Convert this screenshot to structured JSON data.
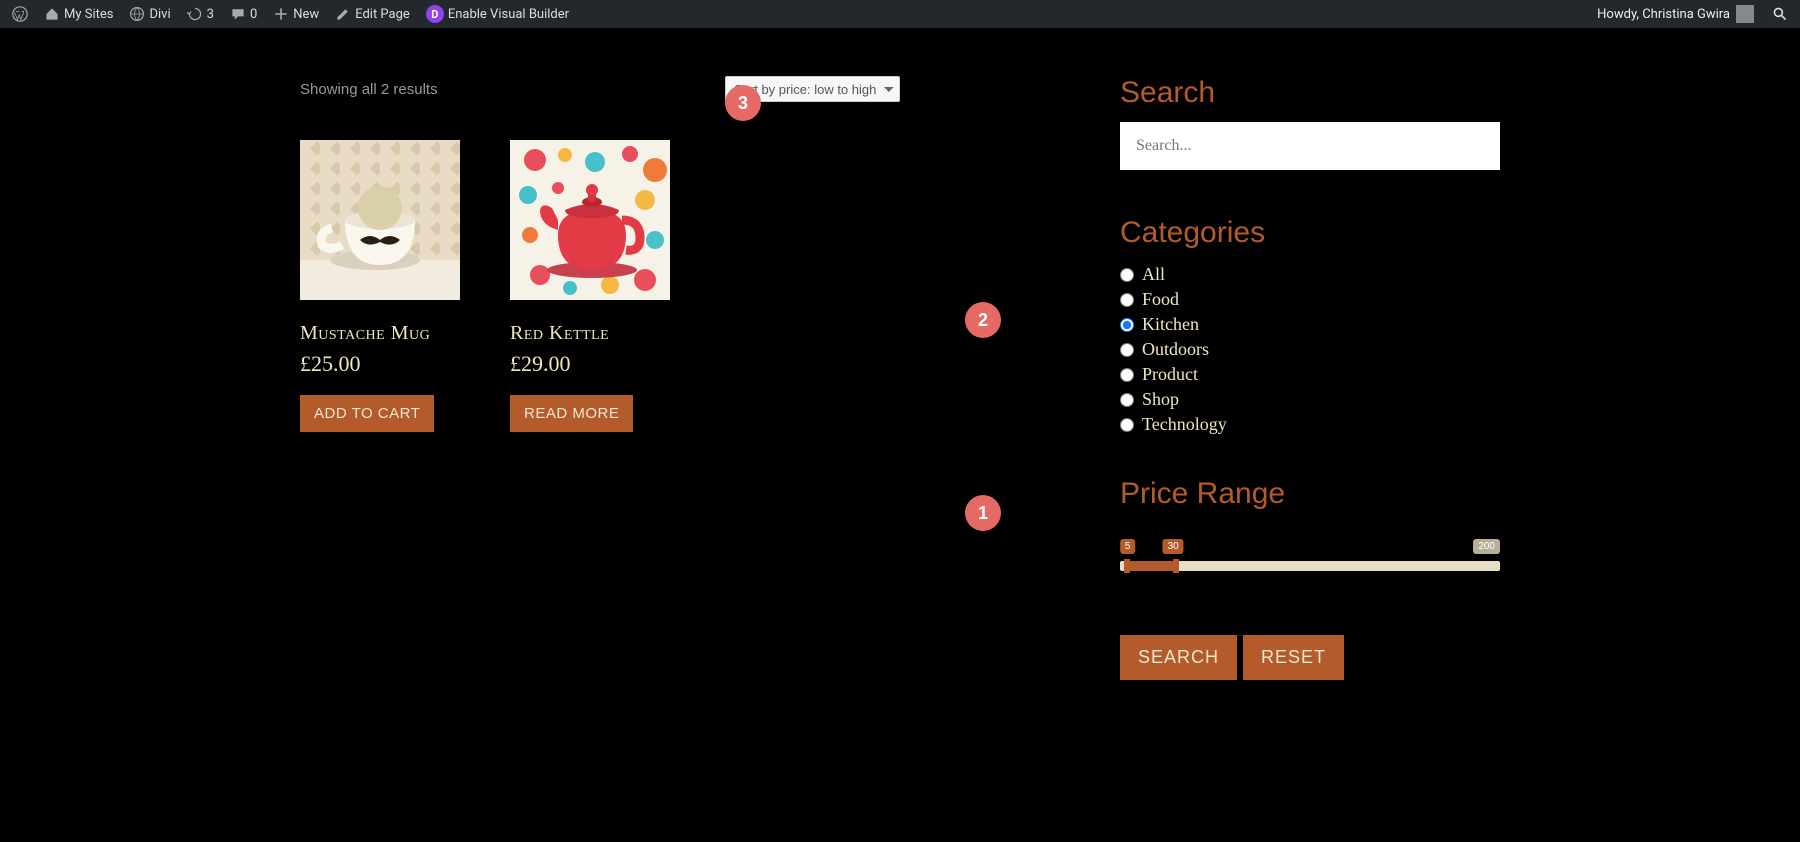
{
  "adminbar": {
    "my_sites": "My Sites",
    "site_name": "Divi",
    "updates": "3",
    "comments": "0",
    "new": "New",
    "edit_page": "Edit Page",
    "enable_vb": "Enable Visual Builder",
    "howdy": "Howdy, Christina Gwira"
  },
  "shop": {
    "result_text": "Showing all 2 results",
    "sort_selected": "Sort by price: low to high",
    "products": [
      {
        "name": "Mustache Mug",
        "price": "£25.00",
        "button": "ADD TO CART"
      },
      {
        "name": "Red Kettle",
        "price": "£29.00",
        "button": "READ MORE"
      }
    ]
  },
  "sidebar": {
    "search_title": "Search",
    "search_placeholder": "Search...",
    "categories_title": "Categories",
    "categories": [
      "All",
      "Food",
      "Kitchen",
      "Outdoors",
      "Product",
      "Shop",
      "Technology"
    ],
    "selected_category": "Kitchen",
    "price_title": "Price Range",
    "slider": {
      "low": "5",
      "high": "30",
      "max": "200"
    },
    "search_btn": "SEARCH",
    "reset_btn": "RESET"
  },
  "annotations": {
    "a1": "1",
    "a2": "2",
    "a3": "3"
  }
}
